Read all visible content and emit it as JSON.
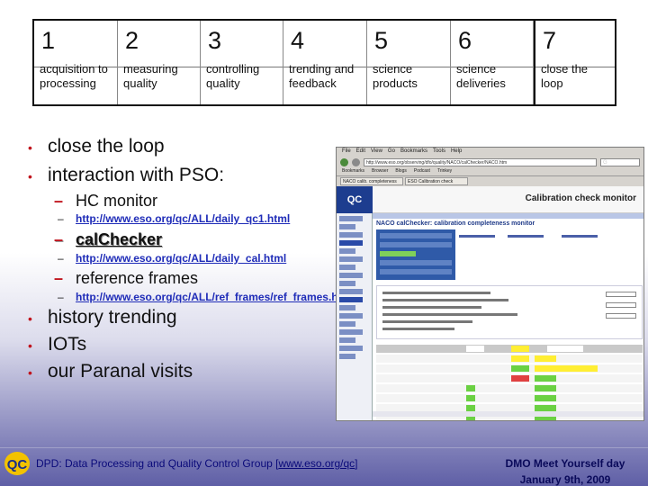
{
  "steps": [
    {
      "num": "1",
      "label": "acquisition to processing"
    },
    {
      "num": "2",
      "label": "measuring quality"
    },
    {
      "num": "3",
      "label": "controlling quality"
    },
    {
      "num": "4",
      "label": "trending and feedback"
    },
    {
      "num": "5",
      "label": "science products"
    },
    {
      "num": "6",
      "label": "science deliveries"
    },
    {
      "num": "7",
      "label": "close the loop"
    }
  ],
  "bullets": {
    "close_loop": "close the loop",
    "interaction": "interaction with PSO:",
    "hc_monitor": "HC monitor",
    "hc_url": "http://www.eso.org/qc/ALL/daily_qc1.html",
    "calchecker": "calChecker",
    "cal_url": "http://www.eso.org/qc/ALL/daily_cal.html",
    "ref_frames": "reference frames",
    "ref_url": "http://www.eso.org/qc/ALL/ref_frames/ref_frames.html",
    "history": "history trending",
    "iots": "IOTs",
    "paranal": "our Paranal visits"
  },
  "browser": {
    "menu": [
      "File",
      "Edit",
      "View",
      "Go",
      "Bookmarks",
      "Tools",
      "Help"
    ],
    "url": "http://www.eso.org/observing/dfo/quality/NACO/calChecker/NACO.htm",
    "search_placeholder": "G",
    "bookmarks": [
      "Bookmarks",
      "Browser",
      "Blogs",
      "Podcast",
      "Trinkey"
    ],
    "tabs": [
      "NACO calib. completeness",
      "ESO Calibration check"
    ],
    "logo": "QC",
    "page_title": "Calibration check monitor",
    "report_title": "NACO calChecker: calibration completeness monitor"
  },
  "footer": {
    "group_prefix": "DPD: Data Processing and Quality Control Group [",
    "group_link": "www.eso.org/qc",
    "group_suffix": "]",
    "event": "DMO Meet Yourself day",
    "date": "January 9th, 2009"
  },
  "colors": {
    "bullet_red": "#c0141d",
    "link_blue": "#1f2cb8",
    "footer_navy": "#0a0a7a"
  }
}
